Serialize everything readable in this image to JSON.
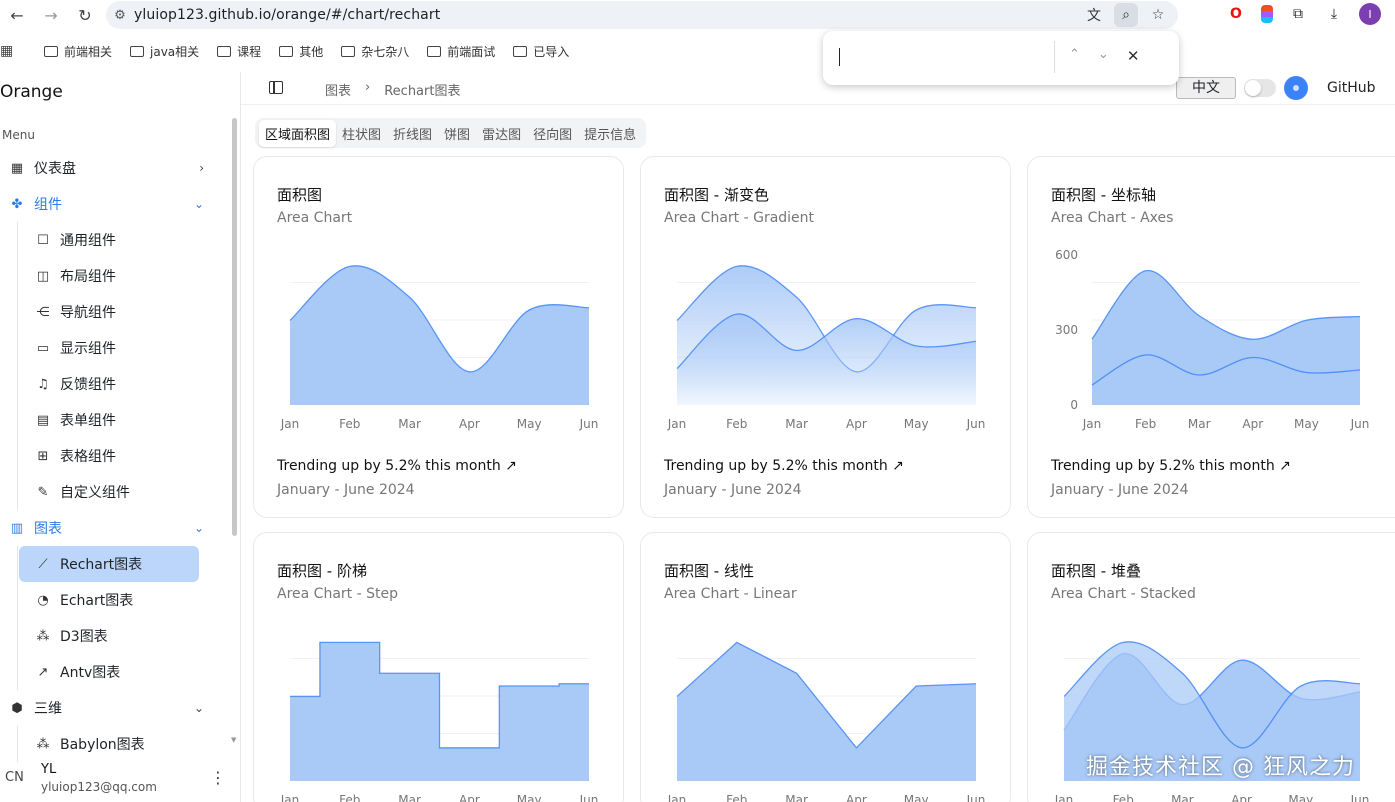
{
  "browser": {
    "url": "yluiop123.github.io/orange/#/chart/rechart",
    "bookmarks": [
      "前端相关",
      "java相关",
      "课程",
      "其他",
      "杂七杂八",
      "前端面试",
      "已导入"
    ],
    "avatar_letter": "I"
  },
  "find_bar": {
    "up": "⌃",
    "down": "⌄",
    "close": "✕"
  },
  "app": {
    "brand": "Orange",
    "menu_label": "Menu",
    "nav": {
      "dashboard": "仪表盘",
      "components": "组件",
      "components_children": [
        "通用组件",
        "布局组件",
        "导航组件",
        "显示组件",
        "反馈组件",
        "表单组件",
        "表格组件",
        "自定义组件"
      ],
      "charts": "图表",
      "charts_children": [
        "Rechart图表",
        "Echart图表",
        "D3图表",
        "Antv图表"
      ],
      "three_d": "三维",
      "three_d_children": [
        "Babylon图表"
      ]
    },
    "user": {
      "avatar": "CN",
      "name": "YL",
      "email": "yluiop123@qq.com"
    }
  },
  "topbar": {
    "breadcrumb": [
      "图表",
      "Rechart图表"
    ],
    "breadcrumb_sep": "›",
    "lang": "中文",
    "github": "GitHub"
  },
  "tabs": [
    "区域面积图",
    "柱状图",
    "折线图",
    "饼图",
    "雷达图",
    "径向图",
    "提示信息"
  ],
  "cards": [
    {
      "title": "面积图",
      "subtitle": "Area Chart",
      "trend": "Trending up by 5.2% this month",
      "range": "January - June 2024"
    },
    {
      "title": "面积图 - 渐变色",
      "subtitle": "Area Chart - Gradient",
      "trend": "Trending up by 5.2% this month",
      "range": "January - June 2024"
    },
    {
      "title": "面积图 - 坐标轴",
      "subtitle": "Area Chart - Axes",
      "trend": "Trending up by 5.2% this month",
      "range": "January - June 2024"
    },
    {
      "title": "面积图 - 阶梯",
      "subtitle": "Area Chart - Step"
    },
    {
      "title": "面积图 - 线性",
      "subtitle": "Area Chart - Linear"
    },
    {
      "title": "面积图 - 堆叠",
      "subtitle": "Area Chart - Stacked"
    }
  ],
  "chart_data": [
    {
      "type": "area",
      "categories": [
        "Jan",
        "Feb",
        "Mar",
        "Apr",
        "May",
        "Jun"
      ],
      "series": [
        {
          "values": [
            186,
            305,
            237,
            73,
            209,
            214
          ]
        }
      ],
      "interpolation": "smooth"
    },
    {
      "type": "area",
      "categories": [
        "Jan",
        "Feb",
        "Mar",
        "Apr",
        "May",
        "Jun"
      ],
      "series": [
        {
          "values": [
            186,
            305,
            237,
            73,
            209,
            214
          ]
        },
        {
          "values": [
            80,
            200,
            120,
            190,
            130,
            140
          ]
        }
      ],
      "fill": "gradient"
    },
    {
      "type": "area",
      "categories": [
        "Jan",
        "Feb",
        "Mar",
        "Apr",
        "May",
        "Jun"
      ],
      "yticks": [
        0,
        300,
        600
      ],
      "ylim": [
        0,
        600
      ],
      "series": [
        {
          "values": [
            264,
            537,
            357,
            263,
            339,
            354
          ]
        },
        {
          "values": [
            80,
            200,
            120,
            190,
            130,
            140
          ]
        }
      ]
    },
    {
      "type": "area",
      "categories": [
        "Jan",
        "Feb",
        "Mar",
        "Apr",
        "May",
        "Jun"
      ],
      "series": [
        {
          "values": [
            186,
            305,
            237,
            73,
            209,
            214
          ]
        }
      ],
      "interpolation": "step"
    },
    {
      "type": "area",
      "categories": [
        "Jan",
        "Feb",
        "Mar",
        "Apr",
        "May",
        "Jun"
      ],
      "series": [
        {
          "values": [
            186,
            305,
            237,
            73,
            209,
            214
          ]
        }
      ],
      "interpolation": "linear"
    },
    {
      "type": "area",
      "categories": [
        "Jan",
        "Feb",
        "Mar",
        "Apr",
        "May",
        "Jun"
      ],
      "series": [
        {
          "values": [
            186,
            305,
            237,
            73,
            209,
            214
          ]
        },
        {
          "values": [
            80,
            200,
            120,
            190,
            130,
            140
          ]
        }
      ],
      "stacked": true
    }
  ],
  "colors": {
    "accent": "#2f7be6",
    "area_fill": "#a9c9f7",
    "area_line": "#3b82f6",
    "active_nav": "#bcd6fb"
  },
  "watermark": "掘金技术社区 @ 狂风之力"
}
